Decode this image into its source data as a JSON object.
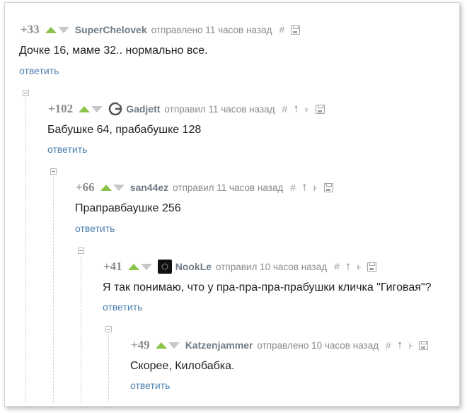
{
  "comments": [
    {
      "rating": "+33",
      "author": "SuperChelovek",
      "time": "отправлено 11 часов назад",
      "text": "Дочке 16, маме 32.. нормально все.",
      "reply": "ответить"
    },
    {
      "rating": "+102",
      "author": "Gadjett",
      "time": "отправил 11 часов назад",
      "text": "Бабушке 64, прабабушке 128",
      "reply": "ответить"
    },
    {
      "rating": "+66",
      "author": "san44ez",
      "time": "отправил 11 часов назад",
      "text": "Праправбаушке 256",
      "reply": "ответить"
    },
    {
      "rating": "+41",
      "author": "NookLe",
      "time": "отправил 10 часов назад",
      "text": "Я так понимаю, что у пра-пра-пра-прабушки  кличка \"Гиговая\"?",
      "reply": "ответить"
    },
    {
      "rating": "+49",
      "author": "Katzenjammer",
      "time": "отправлено 10 часов назад",
      "text": "Скорее, Килобабка.",
      "reply": "ответить"
    }
  ],
  "icons": {
    "hash": "#",
    "parent": "⭡",
    "branch": "ⱶ"
  },
  "colors": {
    "upvote": "#8bc34a",
    "downvote": "#c8c8c8",
    "reply_link": "#4a7fb0",
    "author": "#6e7b86"
  }
}
